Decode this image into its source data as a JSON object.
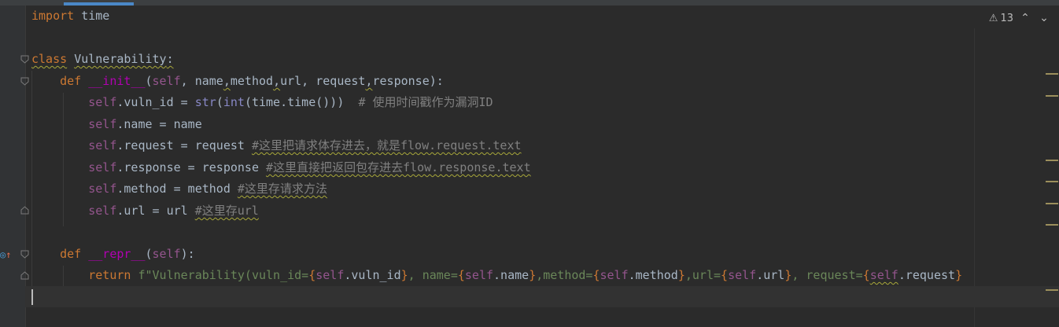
{
  "editor": {
    "lines": {
      "l1": {
        "t1": "import",
        "t2": " time"
      },
      "l3": {
        "t1": "class",
        "t2": " ",
        "t3": "Vulnerability",
        "t4": ":"
      },
      "l4": {
        "t1": "    ",
        "t2": "def",
        "t3": " ",
        "t4": "__init__",
        "t5": "(",
        "t6": "self",
        "t7": ", name",
        "t8": ",",
        "t9": "method",
        "t10": ",",
        "t11": "url, request",
        "t12": ",",
        "t13": "response):"
      },
      "l5": {
        "t1": "        ",
        "t2": "self",
        "t3": ".vuln_id = ",
        "t4": "str",
        "t5": "(",
        "t6": "int",
        "t7": "(time.time()))  ",
        "t8": "# 使用时间戳作为漏洞ID"
      },
      "l6": {
        "t1": "        ",
        "t2": "self",
        "t3": ".name = name"
      },
      "l7": {
        "t1": "        ",
        "t2": "self",
        "t3": ".request = request ",
        "t4": "#这里把请求体存进去，就是flow.request.text"
      },
      "l8": {
        "t1": "        ",
        "t2": "self",
        "t3": ".response = response ",
        "t4": "#这里直接把返回包存进去flow.response.text"
      },
      "l9": {
        "t1": "        ",
        "t2": "self",
        "t3": ".method = method ",
        "t4": "#这里存请求方法"
      },
      "l10": {
        "t1": "        ",
        "t2": "self",
        "t3": ".url = url ",
        "t4": "#这里存url"
      },
      "l12": {
        "t1": "    ",
        "t2": "def",
        "t3": " ",
        "t4": "__repr__",
        "t5": "(",
        "t6": "self",
        "t7": "):"
      },
      "l13": {
        "t1": "        ",
        "t2": "return",
        "t3": " ",
        "t4": "f\"Vulnerability(vuln_id=",
        "t5": "{",
        "t6": "self",
        "t7": ".vuln_id",
        "t8": "}",
        "t9": ", name=",
        "t10": "{",
        "t11": "self",
        "t12": ".name",
        "t13": "}",
        "t14": ",method=",
        "t15": "{",
        "t16": "self",
        "t17": ".method",
        "t18": "}",
        "t19": ",url=",
        "t20": "{",
        "t21": "self",
        "t22": ".url",
        "t23": "}",
        "t24": ", request=",
        "t25": "{",
        "t26": "self",
        "t27": ".request",
        "t28": "}"
      }
    }
  },
  "inspections": {
    "warning_count": "13",
    "warning_icon": "warning-triangle-icon",
    "prev_icon": "chevron-up-icon",
    "next_icon": "chevron-down-icon"
  },
  "colors": {
    "keyword": "#cc7832",
    "self": "#94558d",
    "builtin": "#8888c6",
    "string": "#6a8759",
    "comment": "#808080",
    "text": "#a9b7c6",
    "background": "#2b2b2b"
  }
}
